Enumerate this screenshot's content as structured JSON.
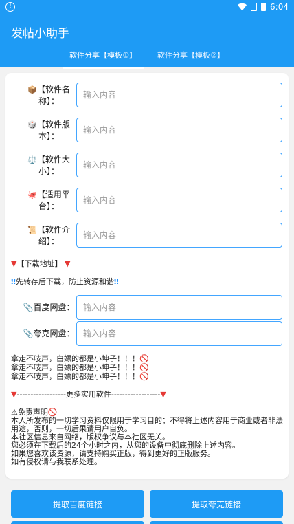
{
  "status": {
    "time": "6:04"
  },
  "app": {
    "title": "发帖小助手"
  },
  "tabs": [
    "软件分享【模板①】",
    "软件分享【模板②】"
  ],
  "fields": [
    {
      "emoji": "📦",
      "label": "【软件名称】：",
      "placeholder": "输入内容",
      "value": ""
    },
    {
      "emoji": "🎲",
      "label": "【软件版本】：",
      "placeholder": "输入内容",
      "value": ""
    },
    {
      "emoji": "⚖️",
      "label": "【软件大小】：",
      "placeholder": "输入内容",
      "value": ""
    },
    {
      "emoji": "🐙",
      "label": "【适用平台】：",
      "placeholder": "输入内容",
      "value": ""
    },
    {
      "emoji": "📜",
      "label": "【软件介绍】：",
      "placeholder": "输入内容",
      "value": ""
    }
  ],
  "download": {
    "heading": "【下载地址】",
    "note": "先转存后下载，防止资源和谐",
    "links": [
      {
        "label": "百度网盘：",
        "placeholder": "输入内容",
        "value": ""
      },
      {
        "label": "夸克网盘：",
        "placeholder": "输入内容",
        "value": ""
      }
    ]
  },
  "warnings": [
    "拿走不吱声，白嫖的都是小坤子！！！",
    "拿走不吱声，白嫖的都是小坤子！！！",
    "拿走不吱声，白嫖的都是小坤子！！！"
  ],
  "more": "------------------更多实用软件------------------",
  "disclaimer": {
    "title": "免责声明",
    "lines": [
      "本人所发布的一切学习资料仅限用于学习目的；不得将上述内容用于商业或者非法用途，否则，一切后果请用户自负。",
      "本社区信息来自网络，版权争议与本社区无关。",
      "您必须在下载后的24个小时之内，从您的设备中彻底删除上述内容。",
      "如果您喜欢该资源，请支持购买正版，得到更好的正版服务。",
      "如有侵权请与我联系处理。"
    ]
  },
  "buttons": {
    "baidu": "提取百度链接",
    "quark": "提取夸克链接"
  },
  "colors": {
    "primary": "#1e9bf5",
    "input_border": "#43a6ff",
    "accent_red": "#e53935"
  }
}
